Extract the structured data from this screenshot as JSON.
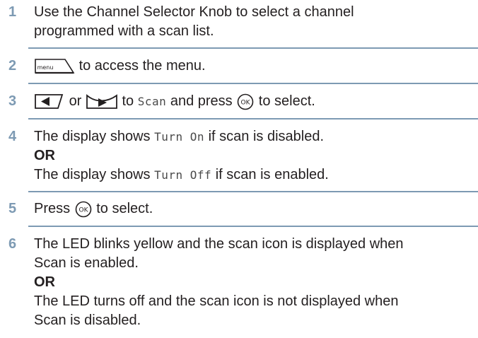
{
  "steps": [
    {
      "number": "1",
      "lines": [
        "Use the Channel Selector Knob to select a channel",
        "programmed with a scan list."
      ]
    },
    {
      "number": "2",
      "menu_key_label": "menu",
      "text": "to access the menu."
    },
    {
      "number": "3",
      "or_word": "or",
      "to_word": "to",
      "scan_display": "Scan",
      "mid_text": "and press",
      "end_text": "to select.",
      "ok_key_label": "OK"
    },
    {
      "number": "4",
      "line1_prefix": "The display shows",
      "line1_display": "Turn On",
      "line1_suffix": "if scan is disabled.",
      "or_label": "OR",
      "line2_prefix": "The display shows",
      "line2_display": "Turn Off",
      "line2_suffix": "if scan is enabled."
    },
    {
      "number": "5",
      "prefix": "Press",
      "ok_key_label": "OK",
      "suffix": "to select."
    },
    {
      "number": "6",
      "lines_a": [
        "The LED blinks yellow and the scan icon is displayed when",
        "Scan is enabled."
      ],
      "or_label": "OR",
      "lines_b": [
        "The LED turns off and the scan icon is not displayed when",
        "Scan is disabled."
      ]
    }
  ]
}
